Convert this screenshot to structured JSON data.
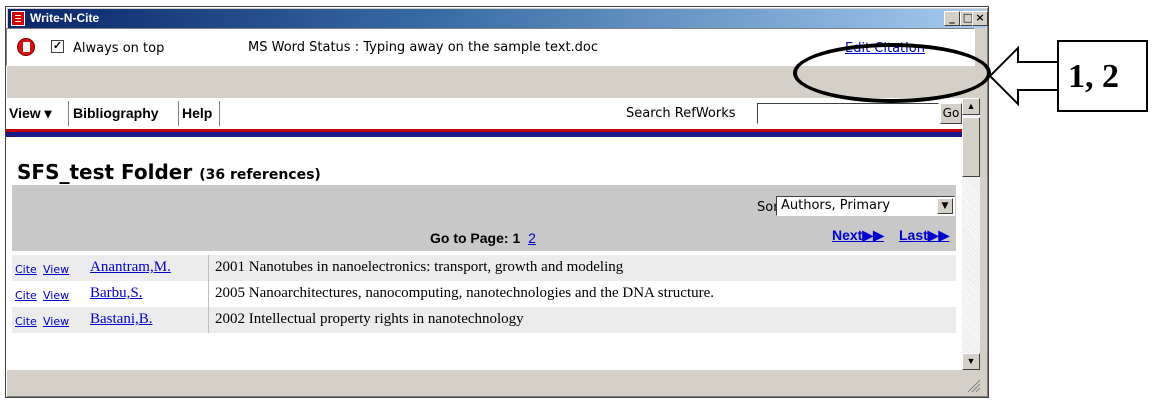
{
  "window": {
    "title": "Write-N-Cite",
    "buttons": {
      "minimize": "_",
      "maximize": "□",
      "close": "×"
    }
  },
  "status_toolbar": {
    "always_on_top_label": "Always on top",
    "always_on_top_checked": true,
    "checkbox_mark": "✓",
    "word_status": "MS Word Status : Typing away on the sample text.doc",
    "edit_citation_label": "Edit Citation"
  },
  "annotation": {
    "callout_text": "1, 2"
  },
  "menubar": {
    "view_label": "View ▾",
    "bibliography_label": "Bibliography",
    "help_label": "Help",
    "search_label": "Search RefWorks",
    "search_value": "",
    "go_label": "Go"
  },
  "folder": {
    "name": "SFS_test Folder",
    "count_text": "(36 references)"
  },
  "sort": {
    "label": "Sort by",
    "selected": "Authors, Primary",
    "arrow": "▼"
  },
  "pagination": {
    "goto_label": "Go to Page:",
    "current_page": "1",
    "other_page": "2",
    "next_label": "Next▶▶",
    "last_label": "Last▶▶"
  },
  "references": [
    {
      "cite": "Cite",
      "view": "View",
      "author": "Anantram,M.",
      "year": "2001",
      "title": "Nanotubes in nanoelectronics: transport, growth and modeling"
    },
    {
      "cite": "Cite",
      "view": "View",
      "author": "Barbu,S.",
      "year": "2005",
      "title": "Nanoarchitectures, nanocomputing, nanotechnologies and the DNA structure."
    },
    {
      "cite": "Cite",
      "view": "View",
      "author": "Bastani,B.",
      "year": "2002",
      "title": "Intellectual property rights in nanotechnology"
    }
  ],
  "scrollbar": {
    "up": "▲",
    "down": "▼"
  },
  "colors": {
    "title_gradient_start": "#0a246a",
    "link": "#0000cc",
    "accent_red": "#c00000",
    "accent_blue": "#1a1a8a"
  }
}
